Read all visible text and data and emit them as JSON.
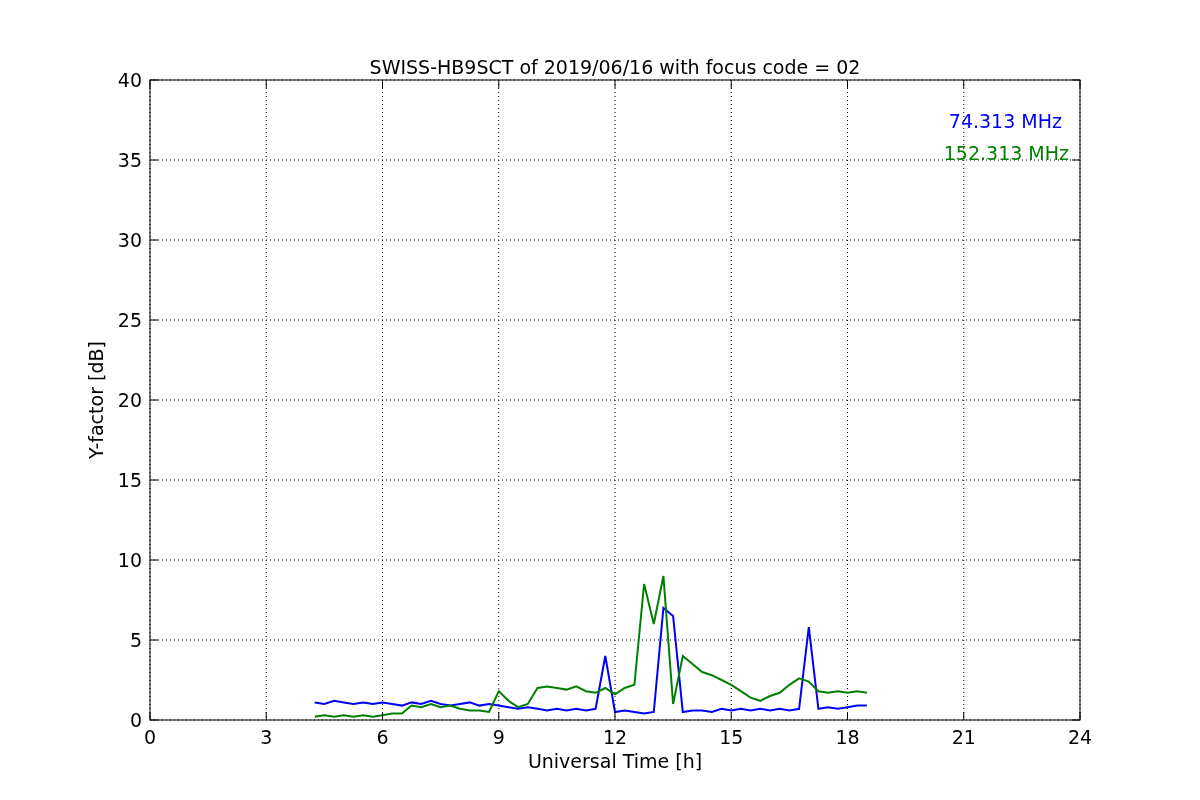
{
  "chart_data": {
    "type": "line",
    "title": "SWISS-HB9SCT of 2019/06/16 with focus code = 02",
    "xlabel": "Universal Time [h]",
    "ylabel": "Y-factor [dB]",
    "x": [
      4.25,
      4.5,
      4.75,
      5,
      5.25,
      5.5,
      5.75,
      6,
      6.25,
      6.5,
      6.75,
      7,
      7.25,
      7.5,
      7.75,
      8,
      8.25,
      8.5,
      8.75,
      9,
      9.25,
      9.5,
      9.75,
      10,
      10.25,
      10.5,
      10.75,
      11,
      11.25,
      11.5,
      11.75,
      12,
      12.25,
      12.5,
      12.75,
      13,
      13.25,
      13.5,
      13.75,
      14,
      14.25,
      14.5,
      14.75,
      15,
      15.25,
      15.5,
      15.75,
      16,
      16.25,
      16.5,
      16.75,
      17,
      17.25,
      17.5,
      17.75,
      18,
      18.25,
      18.5
    ],
    "series": [
      {
        "name": "74.313 MHz",
        "color": "#0000ff",
        "values": [
          1.1,
          1.0,
          1.2,
          1.1,
          1.0,
          1.1,
          1.0,
          1.1,
          1.0,
          0.9,
          1.1,
          1.0,
          1.2,
          1.0,
          0.9,
          1.0,
          1.1,
          0.9,
          1.0,
          0.9,
          0.8,
          0.7,
          0.8,
          0.7,
          0.6,
          0.7,
          0.6,
          0.7,
          0.6,
          0.7,
          4.0,
          0.5,
          0.6,
          0.5,
          0.4,
          0.5,
          7.0,
          6.5,
          0.5,
          0.6,
          0.6,
          0.5,
          0.7,
          0.6,
          0.7,
          0.6,
          0.7,
          0.6,
          0.7,
          0.6,
          0.7,
          5.8,
          0.7,
          0.8,
          0.7,
          0.8,
          0.9,
          0.9
        ]
      },
      {
        "name": "152.313 MHz",
        "color": "#008000",
        "values": [
          0.2,
          0.3,
          0.2,
          0.3,
          0.2,
          0.3,
          0.2,
          0.3,
          0.4,
          0.4,
          0.9,
          0.8,
          1.0,
          0.8,
          0.9,
          0.7,
          0.6,
          0.6,
          0.5,
          1.8,
          1.2,
          0.8,
          1.0,
          2.0,
          2.1,
          2.0,
          1.9,
          2.1,
          1.8,
          1.7,
          2.0,
          1.6,
          2.0,
          2.2,
          8.5,
          6.0,
          9.0,
          1.0,
          4.0,
          3.5,
          3.0,
          2.8,
          2.5,
          2.2,
          1.8,
          1.4,
          1.2,
          1.5,
          1.7,
          2.2,
          2.6,
          2.4,
          1.8,
          1.7,
          1.8,
          1.7,
          1.8,
          1.7
        ]
      }
    ],
    "xlim": [
      0,
      24
    ],
    "ylim": [
      0,
      40
    ],
    "xticks": [
      0,
      3,
      6,
      9,
      12,
      15,
      18,
      21,
      24
    ],
    "yticks": [
      0,
      5,
      10,
      15,
      20,
      25,
      30,
      35,
      40
    ],
    "grid": true
  }
}
